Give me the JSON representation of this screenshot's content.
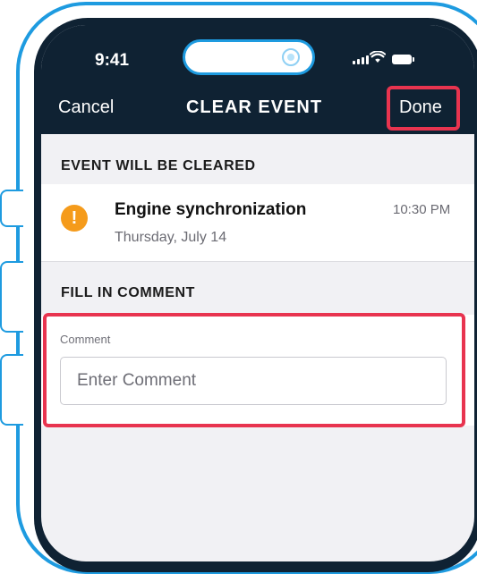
{
  "status_bar": {
    "time": "9:41"
  },
  "nav": {
    "cancel_label": "Cancel",
    "title": "CLEAR EVENT",
    "done_label": "Done"
  },
  "event_section": {
    "header": "EVENT WILL BE CLEARED",
    "event": {
      "icon": "warning-icon",
      "icon_glyph": "!",
      "title": "Engine synchronization",
      "date": "Thursday, July 14",
      "time": "10:30 PM"
    }
  },
  "comment_section": {
    "header": "FILL IN COMMENT",
    "field_label": "Comment",
    "placeholder": "Enter Comment",
    "value": ""
  },
  "colors": {
    "nav_background": "#0f2233",
    "frame": "#1e9be0",
    "highlight": "#e8344f",
    "warning": "#f59b1b"
  }
}
